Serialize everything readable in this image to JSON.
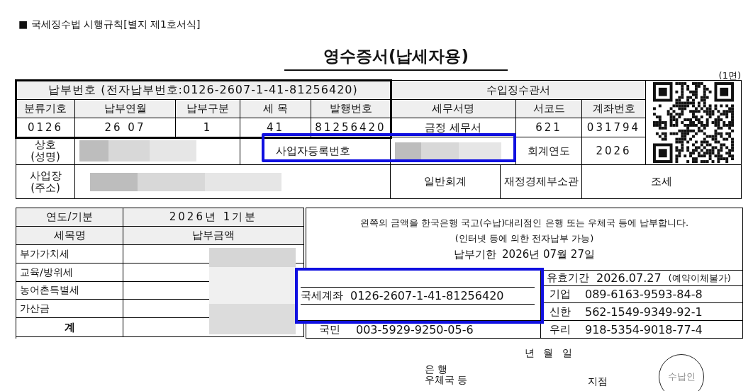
{
  "form_label": "■ 국세징수법 시행규칙[별지 제1호서식]",
  "title": "영수증서(납세자용)",
  "page_label": "(1면)",
  "payment_number_header": "납부번호 (전자납부번호:0126-2607-1-41-81256420)",
  "payment_columns": [
    "분류기호",
    "납부연월",
    "납부구분",
    "세 목",
    "발행번호"
  ],
  "payment_values": [
    "0126",
    "26 07",
    "1",
    "41",
    "81256420"
  ],
  "office_header": "수입징수관서",
  "office_columns": [
    "세무서명",
    "서코드",
    "계좌번호"
  ],
  "office_values": [
    "금정 세무서",
    "621",
    "031794"
  ],
  "name_label": [
    "상호",
    "(성명)"
  ],
  "registration_label": "사업자등록번호",
  "fiscal_year_label": "회계연도",
  "fiscal_year": "2026",
  "address_label": [
    "사업장",
    "(주소)"
  ],
  "account_type": "일반회계",
  "ministry": "재정경제부소관",
  "category": "조세",
  "period": {
    "label": "연도/기분",
    "value": "2026년 1기분"
  },
  "amount_columns": [
    "세목명",
    "납부금액"
  ],
  "amount_rows": [
    {
      "label": "부가가치세",
      "kind": "item"
    },
    {
      "label": "교육/방위세",
      "kind": "item"
    },
    {
      "label": "농어촌특별세",
      "kind": "item"
    },
    {
      "label": "가산금",
      "kind": "item"
    },
    {
      "label": "계",
      "kind": "total"
    }
  ],
  "notice_lines": [
    "왼쪽의 금액을 한국은행 국고(수납)대리점인 은행 또는 우체국 등에 납부합니다.",
    "(인터넷 등에 의한 전자납부 가능)"
  ],
  "due": {
    "label": "납부기한",
    "date": "2026년 07월 27일"
  },
  "validity": {
    "label": "유효기간",
    "date": "2026.07.27",
    "note": "(예약이체불가)"
  },
  "national_account": {
    "label": "국세계좌",
    "number": "0126-2607-1-41-81256420"
  },
  "left_accounts": [
    {
      "bank": "국민",
      "number": "003-5929-9250-05-6"
    }
  ],
  "right_accounts": [
    {
      "bank": "기업",
      "number": "089-6163-9593-84-8"
    },
    {
      "bank": "신한",
      "number": "562-1549-9349-92-1"
    },
    {
      "bank": "우리",
      "number": "918-5354-9018-77-4"
    }
  ],
  "signature": {
    "date": "년  월  일",
    "bank_line1": "은   행",
    "bank_line2": "우체국 등",
    "branch": "지점",
    "stamp": "수납인"
  }
}
